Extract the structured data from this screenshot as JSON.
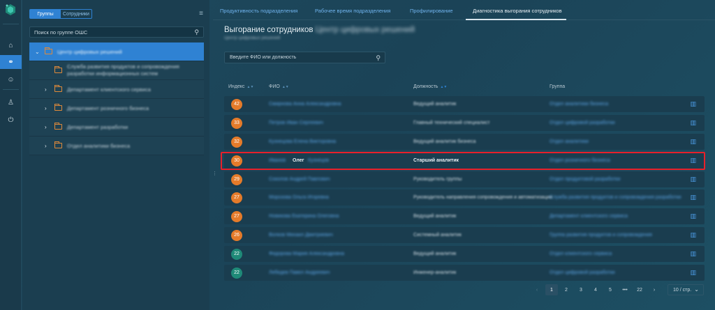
{
  "sidebar_rail": {
    "items": [
      {
        "icon": "building-icon"
      },
      {
        "icon": "hierarchy-icon",
        "active": true
      },
      {
        "icon": "person-icon"
      },
      {
        "icon": "user-icon"
      },
      {
        "icon": "power-icon"
      }
    ]
  },
  "left_panel": {
    "segment": {
      "groups": "Группы",
      "employees": "Сотрудники"
    },
    "search_placeholder": "Поиск по группе ОШС",
    "tree": [
      {
        "label": "Центр цифровых решений",
        "level": 0,
        "expanded": true,
        "selected": true
      },
      {
        "label": "Служба развития продуктов и сопровождения\nразработки информационных систем",
        "level": 1
      },
      {
        "label": "Департамент клиентского сервиса",
        "level": 1,
        "collapsed": true
      },
      {
        "label": "Департамент розничного бизнеса",
        "level": 1,
        "collapsed": true
      },
      {
        "label": "Департамент разработки",
        "level": 1,
        "collapsed": true
      },
      {
        "label": "Отдел аналитики бизнеса",
        "level": 1,
        "collapsed": true
      }
    ]
  },
  "tabs": [
    {
      "label": "Продуктивность подразделения"
    },
    {
      "label": "Рабочее время подразделения"
    },
    {
      "label": "Профилирование"
    },
    {
      "label": "Диагностика выгорания сотрудников",
      "active": true
    }
  ],
  "page": {
    "title": "Выгорание сотрудников",
    "title_suffix": "Центр цифровых решений",
    "subtitle": "Центр цифровых решений",
    "search_placeholder": "Введите ФИО или должность"
  },
  "table": {
    "headers": {
      "index": "Индекс",
      "fio": "ФИО",
      "position": "Должность",
      "group": "Группа"
    },
    "rows": [
      {
        "index": "42",
        "color": "#e57b2a",
        "fio": "Смирнова Анна Александровна",
        "position": "Ведущий аналитик",
        "group": "Отдел аналитики бизнеса"
      },
      {
        "index": "33",
        "color": "#e57b2a",
        "fio": "Петров Иван Сергеевич",
        "position": "Главный технический специалист",
        "group": "Отдел цифровой разработки"
      },
      {
        "index": "32",
        "color": "#e57b2a",
        "fio": "Кузнецова Елена Викторовна",
        "position": "Ведущий аналитик бизнеса",
        "group": "Отдел аналитики"
      },
      {
        "index": "30",
        "color": "#e57b2a",
        "fio": "Иванов",
        "first_name": "Олег",
        "fio_rest": "Кузнецов",
        "position": "Старший аналитик",
        "group": "Отдел розничного бизнеса",
        "highlight": true
      },
      {
        "index": "29",
        "color": "#e57b2a",
        "fio": "Соколов Андрей Павлович",
        "position": "Руководитель группы",
        "group": "Отдел продуктовой разработки"
      },
      {
        "index": "27",
        "color": "#e57b2a",
        "fio": "Морозова Ольга Игоревна",
        "position": "Руководитель направления сопровождения и автоматизации",
        "group": "Служба развития продуктов и сопровождения разработки"
      },
      {
        "index": "27",
        "color": "#e57b2a",
        "fio": "Новикова Екатерина Олеговна",
        "position": "Ведущий аналитик",
        "group": "Департамент клиентского сервиса"
      },
      {
        "index": "26",
        "color": "#e57b2a",
        "fio": "Волков Михаил Дмитриевич",
        "position": "Системный аналитик",
        "group": "Группа развития продуктов и сопровождения"
      },
      {
        "index": "22",
        "color": "#1f8a78",
        "fio": "Федорова Мария Александровна",
        "position": "Ведущий аналитик",
        "group": "Отдел клиентского сервиса"
      },
      {
        "index": "22",
        "color": "#1f8a78",
        "fio": "Лебедев Павел Андреевич",
        "position": "Инженер-аналитик",
        "group": "Отдел цифровой разработки"
      }
    ]
  },
  "pagination": {
    "pages": [
      "1",
      "2",
      "3",
      "4",
      "5",
      "•••",
      "22"
    ],
    "current": "1",
    "page_size": "10 / стр."
  }
}
